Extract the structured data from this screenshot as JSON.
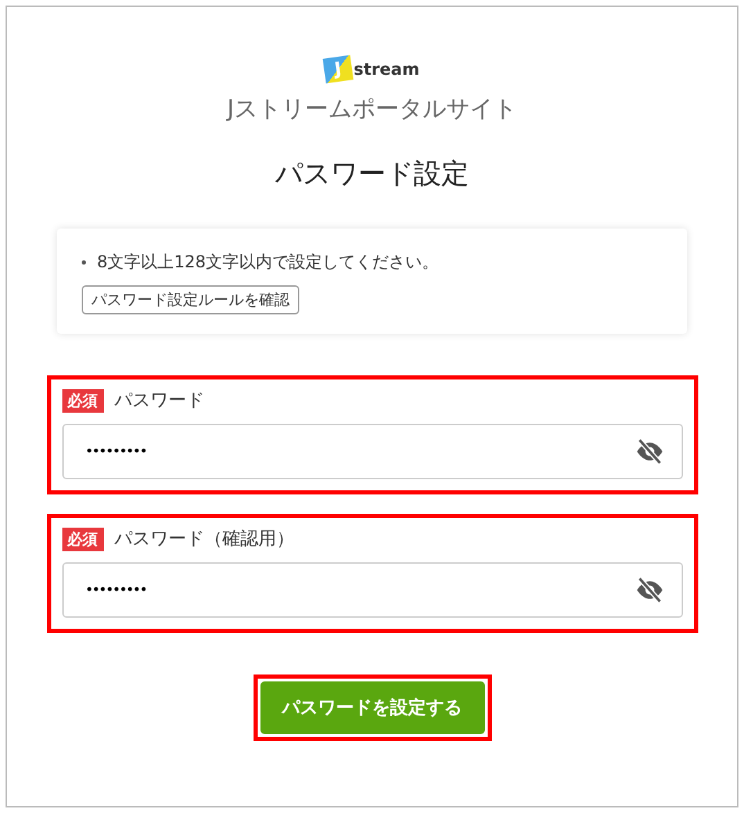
{
  "logo": {
    "mark": "J",
    "text": "stream"
  },
  "site_title": "Jストリームポータルサイト",
  "page_title": "パスワード設定",
  "rules": {
    "items": [
      "8文字以上128文字以内で設定してください。"
    ],
    "button": "パスワード設定ルールを確認"
  },
  "fields": [
    {
      "badge": "必須",
      "label": "パスワード",
      "value": "•••••••••",
      "highlighted": true
    },
    {
      "badge": "必須",
      "label": "パスワード（確認用）",
      "value": "•••••••••",
      "highlighted": true
    }
  ],
  "submit": {
    "label": "パスワードを設定する",
    "highlighted": true
  }
}
